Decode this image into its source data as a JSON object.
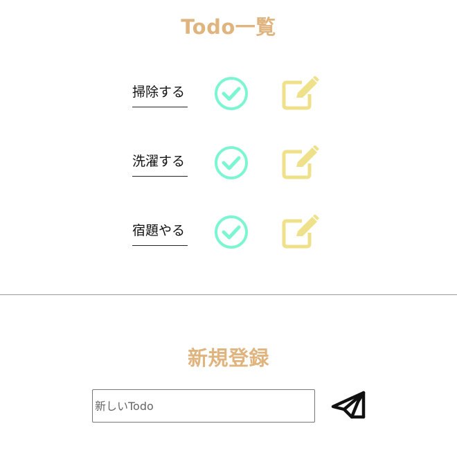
{
  "list_section": {
    "title": "Todo一覧"
  },
  "todos": [
    {
      "label": "掃除する"
    },
    {
      "label": "洗濯する"
    },
    {
      "label": "宿題やる"
    }
  ],
  "register_section": {
    "title": "新規登録",
    "input_placeholder": "新しいTodo",
    "input_value": ""
  },
  "icons": {
    "complete": "check-circle-icon",
    "edit": "edit-pencil-icon",
    "send": "paper-plane-icon"
  },
  "colors": {
    "title": "#dfb47e",
    "check": "#7cf6d2",
    "edit": "#efe08a",
    "send": "#111111"
  }
}
